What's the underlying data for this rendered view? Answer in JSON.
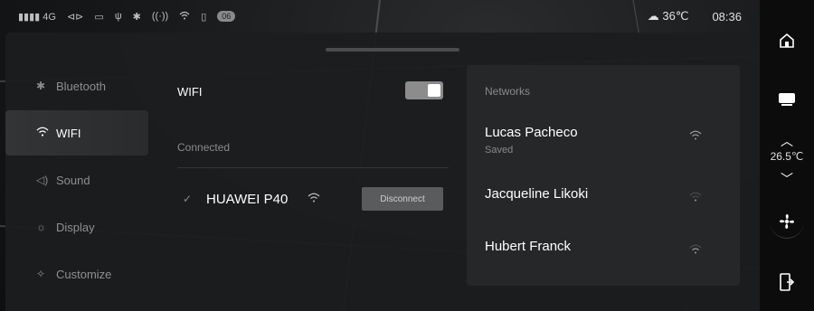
{
  "status_bar": {
    "left_icons": [
      "signal-icon",
      "mirror-icon",
      "camera-icon",
      "usb-icon",
      "bluetooth-icon",
      "hotspot-icon",
      "wifi-icon",
      "battery-icon"
    ],
    "signal_text": "4G",
    "badge": "06",
    "weather_temp": "36℃",
    "time": "08:36"
  },
  "sidebar": {
    "items": [
      {
        "label": "Bluetooth",
        "icon": "bluetooth-icon",
        "active": false
      },
      {
        "label": "WIFI",
        "icon": "wifi-icon",
        "active": true
      },
      {
        "label": "Sound",
        "icon": "speaker-icon",
        "active": false
      },
      {
        "label": "Display",
        "icon": "brightness-icon",
        "active": false
      },
      {
        "label": "Customize",
        "icon": "customize-icon",
        "active": false
      }
    ]
  },
  "wifi": {
    "label": "WIFI",
    "enabled": true,
    "connected_label": "Connected",
    "connected_network": "HUAWEI P40",
    "disconnect_label": "Disconnect"
  },
  "networks": {
    "title": "Networks",
    "items": [
      {
        "name": "Lucas Pacheco",
        "status": "Saved",
        "signal": "strong"
      },
      {
        "name": "Jacqueline Likoki",
        "status": "",
        "signal": "weak"
      },
      {
        "name": "Hubert Franck",
        "status": "",
        "signal": "medium"
      }
    ]
  },
  "dock": {
    "cabin_temp": "26.5℃",
    "icons": [
      "home-icon",
      "screen-icon",
      "temp-up-icon",
      "temp-down-icon",
      "fan-icon",
      "exit-icon"
    ]
  },
  "colors": {
    "panel": "#1c1d1e",
    "card": "#262728",
    "accent_active": "#ffffff",
    "muted_text": "#8a8a8a"
  }
}
